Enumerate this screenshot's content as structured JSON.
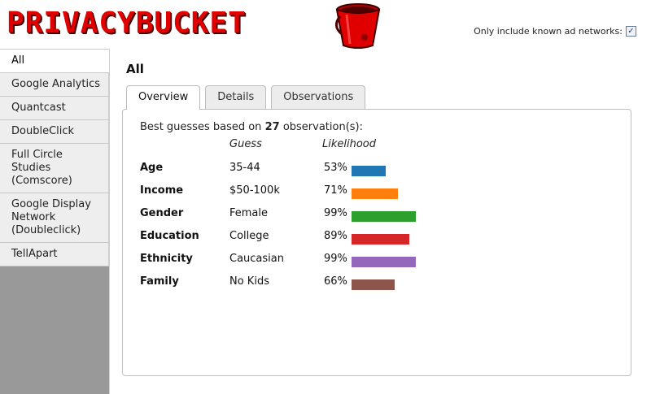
{
  "header": {
    "logo_text": "PRIVACYBUCKET",
    "adnet_label": "Only include known ad networks:",
    "adnet_checked": true
  },
  "sidebar": {
    "items": [
      {
        "label": "All",
        "active": true
      },
      {
        "label": "Google Analytics",
        "active": false
      },
      {
        "label": "Quantcast",
        "active": false
      },
      {
        "label": "DoubleClick",
        "active": false
      },
      {
        "label": "Full Circle Studies (Comscore)",
        "active": false
      },
      {
        "label": "Google Display Network (Doubleclick)",
        "active": false
      },
      {
        "label": "TellApart",
        "active": false
      }
    ]
  },
  "main": {
    "title": "All",
    "tabs": [
      {
        "label": "Overview",
        "active": true
      },
      {
        "label": "Details",
        "active": false
      },
      {
        "label": "Observations",
        "active": false
      }
    ],
    "summary_prefix": "Best guesses based on",
    "observation_count": "27",
    "summary_suffix": "observation(s):",
    "col_guess": "Guess",
    "col_likelihood": "Likelihood",
    "rows": [
      {
        "category": "Age",
        "guess": "35-44",
        "likelihood": "53%",
        "value": 53,
        "color": "#1f77b4"
      },
      {
        "category": "Income",
        "guess": "$50-100k",
        "likelihood": "71%",
        "value": 71,
        "color": "#ff7f0e"
      },
      {
        "category": "Gender",
        "guess": "Female",
        "likelihood": "99%",
        "value": 99,
        "color": "#2ca02c"
      },
      {
        "category": "Education",
        "guess": "College",
        "likelihood": "89%",
        "value": 89,
        "color": "#d62728"
      },
      {
        "category": "Ethnicity",
        "guess": "Caucasian",
        "likelihood": "99%",
        "value": 99,
        "color": "#9467bd"
      },
      {
        "category": "Family",
        "guess": "No Kids",
        "likelihood": "66%",
        "value": 66,
        "color": "#8c564b"
      }
    ]
  }
}
